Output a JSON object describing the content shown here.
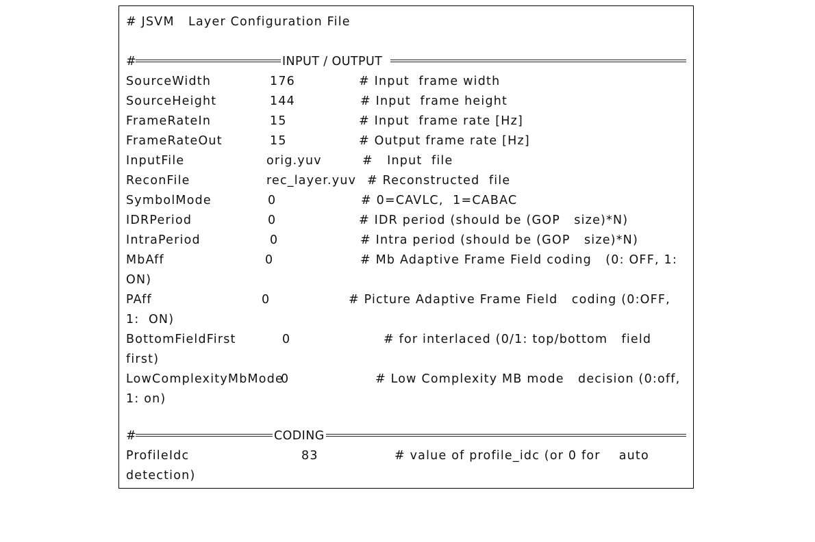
{
  "document": {
    "title": "# JSVM   Layer Configuration File",
    "sections": [
      {
        "hash": "#",
        "label": "INPUT / OUTPUT",
        "rows": [
          {
            "key": "SourceWidth",
            "value": "176",
            "comment": "# Input  frame width",
            "cont": ""
          },
          {
            "key": "SourceHeight",
            "value": "144",
            "comment": "# Input  frame height",
            "cont": ""
          },
          {
            "key": "FrameRateIn",
            "value": "15",
            "comment": "# Input  frame rate [Hz]",
            "cont": ""
          },
          {
            "key": "FrameRateOut",
            "value": "15",
            "comment": "# Output frame rate [Hz]",
            "cont": ""
          },
          {
            "key": "InputFile",
            "value": "orig.yuv",
            "comment": "#   Input  file",
            "cont": ""
          },
          {
            "key": "ReconFile",
            "value": "rec_layer.yuv",
            "comment": "# Reconstructed  file",
            "cont": ""
          },
          {
            "key": "SymbolMode",
            "value": "0",
            "comment": "# 0=CAVLC,  1=CABAC",
            "cont": ""
          },
          {
            "key": "IDRPeriod",
            "value": "0",
            "comment": "# IDR period (should be (GOP   size)*N)",
            "cont": ""
          },
          {
            "key": "IntraPeriod",
            "value": "0",
            "comment": "# Intra period (should be (GOP   size)*N)",
            "cont": ""
          },
          {
            "key": "MbAff",
            "value": "0",
            "comment": "# Mb Adaptive Frame Field coding   (0: OFF, 1:",
            "cont": "ON)"
          },
          {
            "key": "PAff",
            "value": "0",
            "comment": "# Picture Adaptive Frame Field   coding (0:OFF,",
            "cont": "1:  ON)"
          },
          {
            "key": "BottomFieldFirst",
            "value": "0",
            "comment": "# for interlaced (0/1: top/bottom   field",
            "cont": "first)"
          },
          {
            "key": "LowComplexityMbMode",
            "value": "0",
            "comment": "# Low Complexity MB mode   decision (0:off,",
            "cont": "1: on)"
          }
        ]
      },
      {
        "hash": "#",
        "label": "CODING",
        "rows": [
          {
            "key": "ProfileIdc",
            "value": "83",
            "comment": "# value of profile_idc (or 0 for    auto",
            "cont": "detection)"
          }
        ]
      }
    ]
  }
}
